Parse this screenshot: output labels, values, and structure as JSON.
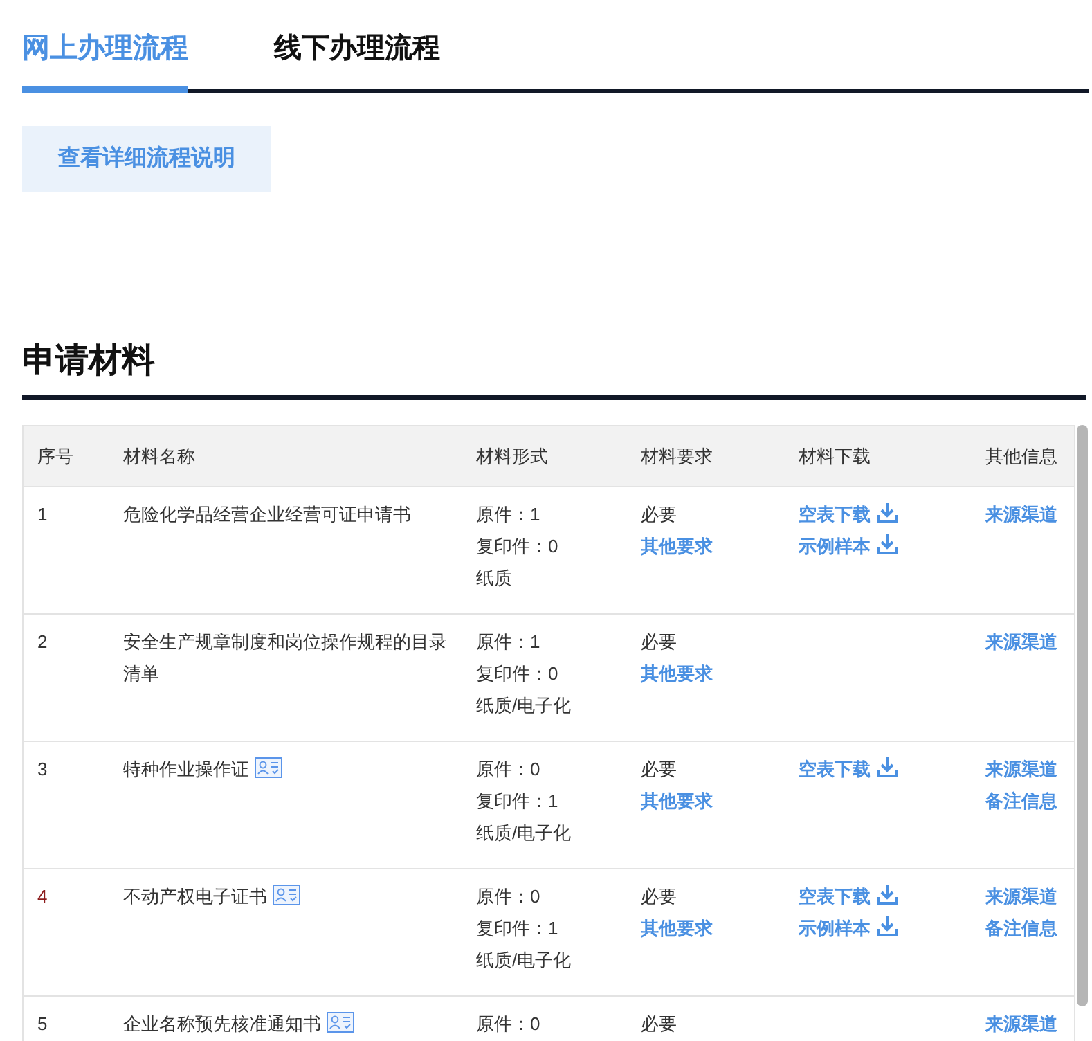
{
  "tabs": [
    {
      "label": "网上办理流程",
      "selected": true
    },
    {
      "label": "线下办理流程",
      "selected": false
    }
  ],
  "detail_button": "查看详细流程说明",
  "section_title": "申请材料",
  "table": {
    "columns": [
      "序号",
      "材料名称",
      "材料形式",
      "材料要求",
      "材料下载",
      "其他信息"
    ],
    "rows": [
      {
        "number": "1",
        "color": "#333333",
        "name": "危险化学品经营企业经营可证申请书",
        "certificate_icon": false,
        "forms": [
          "原件：1",
          "复印件：0",
          "纸质"
        ],
        "requirement": "必要",
        "requirement_link": "其他要求",
        "downloads": [
          "空表下载",
          "示例样本"
        ],
        "other": [
          "来源渠道"
        ]
      },
      {
        "number": "2",
        "color": "#333333",
        "name": "安全生产规章制度和岗位操作规程的目录清单",
        "certificate_icon": false,
        "forms": [
          "原件：1",
          "复印件：0",
          "纸质/电子化"
        ],
        "requirement": "必要",
        "requirement_link": "其他要求",
        "downloads": [],
        "other": [
          "来源渠道"
        ]
      },
      {
        "number": "3",
        "color": "#333333",
        "name": "特种作业操作证",
        "certificate_icon": true,
        "forms": [
          "原件：0",
          "复印件：1",
          "纸质/电子化"
        ],
        "requirement": "必要",
        "requirement_link": "其他要求",
        "downloads": [
          "空表下载"
        ],
        "other": [
          "来源渠道",
          "备注信息"
        ]
      },
      {
        "number": "4",
        "color": "#8b1a1a",
        "name": "不动产权电子证书",
        "certificate_icon": true,
        "forms": [
          "原件：0",
          "复印件：1",
          "纸质/电子化"
        ],
        "requirement": "必要",
        "requirement_link": "其他要求",
        "downloads": [
          "空表下载",
          "示例样本"
        ],
        "other": [
          "来源渠道",
          "备注信息"
        ]
      },
      {
        "number": "5",
        "color": "#333333",
        "name": "企业名称预先核准通知书",
        "certificate_icon": true,
        "forms": [
          "原件：0"
        ],
        "requirement": "必要",
        "downloads": [],
        "other": [
          "来源渠道"
        ]
      }
    ]
  }
}
